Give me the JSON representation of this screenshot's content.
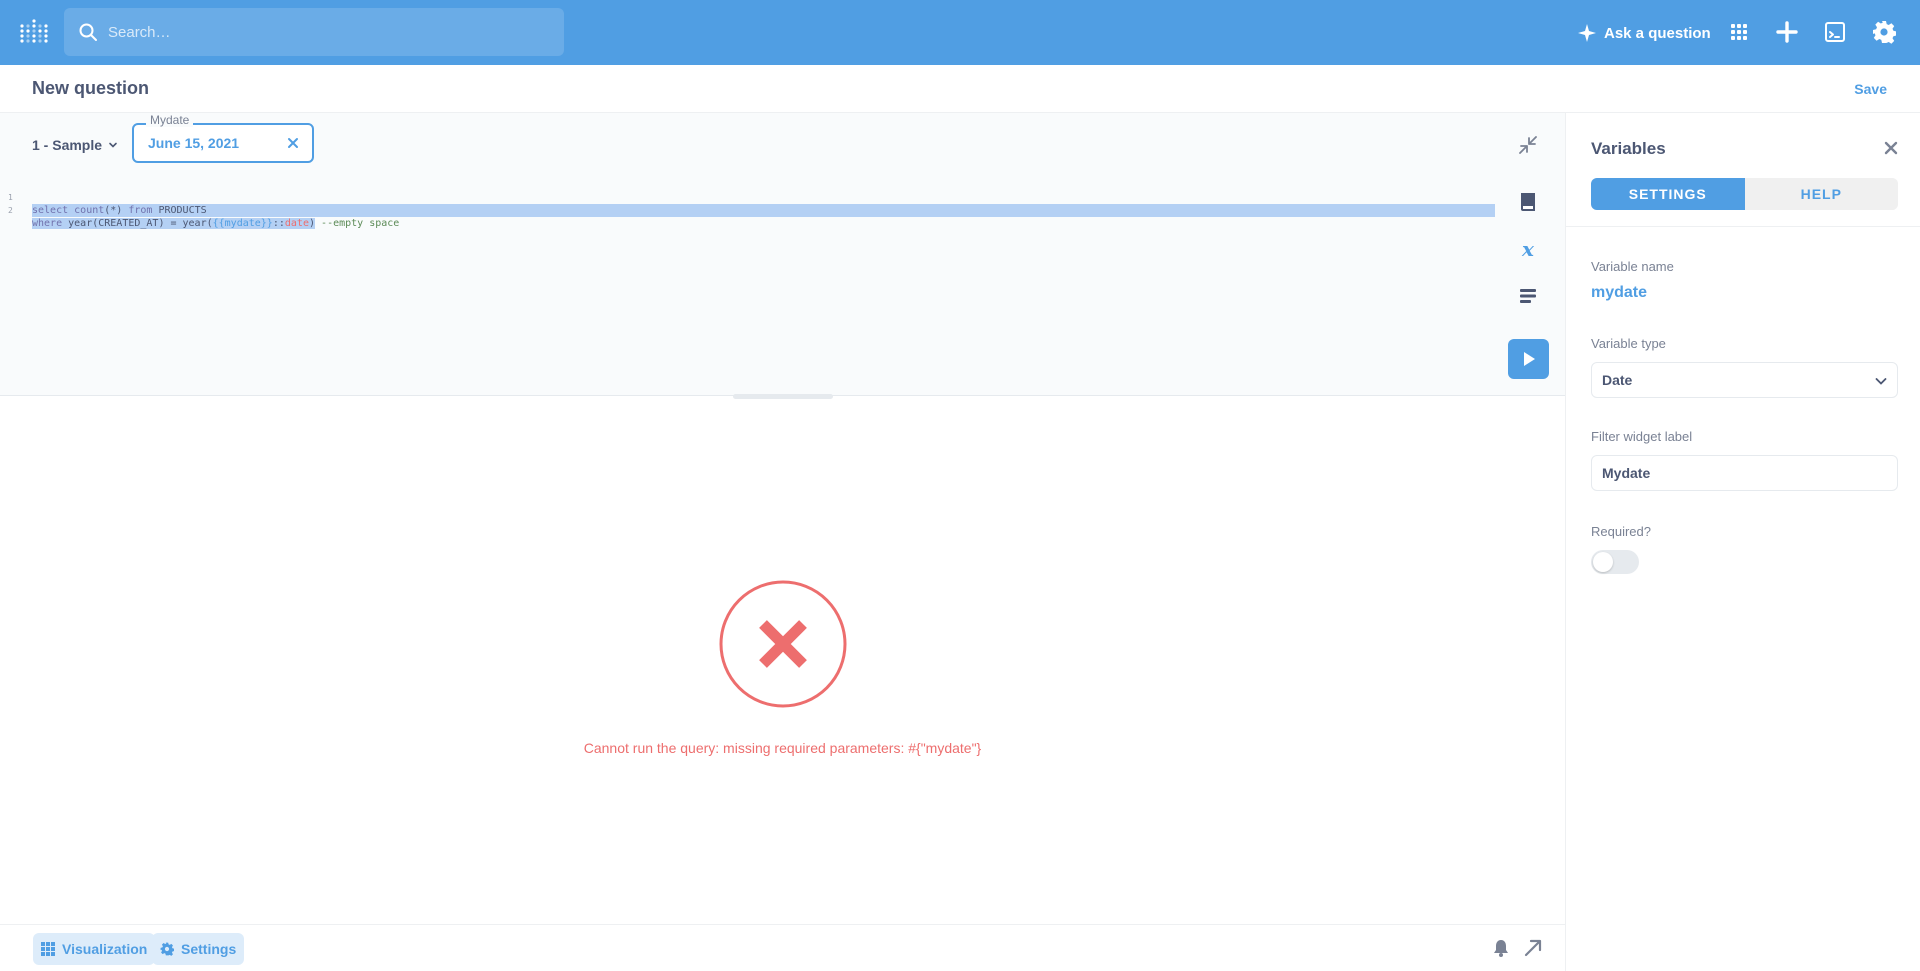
{
  "colors": {
    "brand": "#509ee3",
    "error": "#ed6e6e",
    "text_dark": "#4c5773",
    "text_light": "#7a8294"
  },
  "nav": {
    "search_placeholder": "Search…",
    "ask_label": "Ask a question",
    "icons": [
      "grid-icon",
      "plus-icon",
      "sql-editor-icon",
      "gear-icon"
    ]
  },
  "header": {
    "title": "New question",
    "save_label": "Save"
  },
  "editor": {
    "database": "1 - Sample",
    "parameter": {
      "label": "Mydate",
      "value": "June 15, 2021"
    },
    "lines": [
      {
        "number": "1",
        "text": "select count(*) from PRODUCTS"
      },
      {
        "number": "2",
        "text": "where year(CREATED_AT) = year({{mydate}}::date) --empty space"
      }
    ]
  },
  "result": {
    "error_message": "Cannot run the query: missing required parameters: #{\"mydate\"}"
  },
  "footer": {
    "visualization_label": "Visualization",
    "settings_label": "Settings"
  },
  "sidebar": {
    "title": "Variables",
    "tabs": [
      {
        "label": "SETTINGS",
        "active": true
      },
      {
        "label": "HELP",
        "active": false
      }
    ],
    "variable_name_label": "Variable name",
    "variable_name": "mydate",
    "variable_type_label": "Variable type",
    "variable_type": "Date",
    "widget_label_label": "Filter widget label",
    "widget_label": "Mydate",
    "required_label": "Required?",
    "required": false
  }
}
